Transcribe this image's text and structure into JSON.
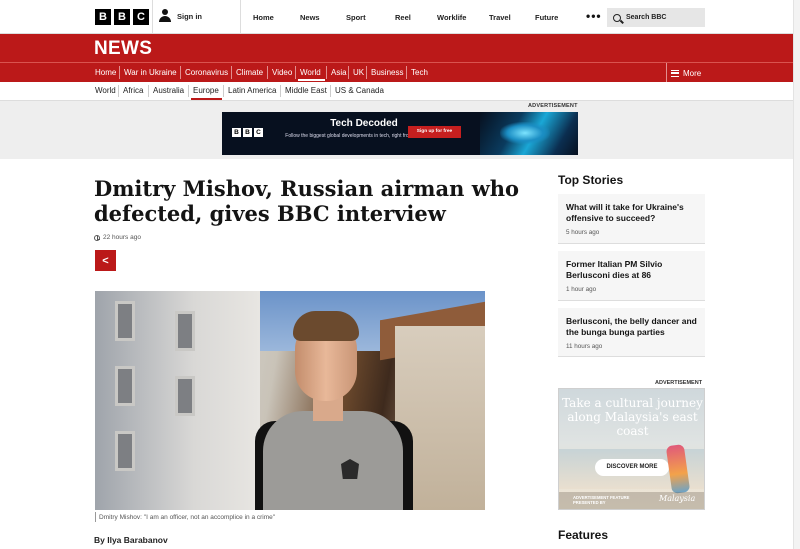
{
  "header": {
    "logo_letters": [
      "B",
      "B",
      "C"
    ],
    "signin_label": "Sign in",
    "nav": [
      "Home",
      "News",
      "Sport",
      "Reel",
      "Worklife",
      "Travel",
      "Future"
    ],
    "search_placeholder": "Search BBC"
  },
  "news_banner": {
    "title": "NEWS"
  },
  "red_nav": {
    "items": [
      "Home",
      "War in Ukraine",
      "Coronavirus",
      "Climate",
      "Video",
      "World",
      "Asia",
      "UK",
      "Business",
      "Tech"
    ],
    "active": "World",
    "more_label": "More"
  },
  "sub_nav": {
    "items": [
      "World",
      "Africa",
      "Australia",
      "Europe",
      "Latin America",
      "Middle East",
      "US & Canada"
    ],
    "active": "Europe"
  },
  "top_ad": {
    "label": "ADVERTISEMENT",
    "logo_letters": [
      "B",
      "B",
      "C"
    ],
    "title": "Tech Decoded",
    "subtitle": "Follow the biggest global developments in tech, right from your inbox.",
    "button": "Sign up for free"
  },
  "article": {
    "headline": "Dmitry Mishov, Russian airman who defected, gives BBC interview",
    "timestamp": "22 hours ago",
    "caption": "Dmitry Mishov: \"I am an officer, not an accomplice in a crime\"",
    "byline": "By Ilya Barabanov"
  },
  "sidebar": {
    "top_stories_title": "Top Stories",
    "stories": [
      {
        "title": "What will it take for Ukraine's offensive to succeed?",
        "time": "5 hours ago"
      },
      {
        "title": "Former Italian PM Silvio Berlusconi dies at 86",
        "time": "1 hour ago"
      },
      {
        "title": "Berlusconi, the belly dancer and the bunga bunga parties",
        "time": "11 hours ago"
      }
    ],
    "ad_label": "ADVERTISEMENT",
    "ad": {
      "headline": "Take a cultural journey along Malaysia's east coast",
      "button": "DISCOVER MORE",
      "footer": "ADVERTISEMENT FEATURE PRESENTED BY",
      "brand": "Malaysia"
    },
    "features_title": "Features"
  },
  "colors": {
    "bbc_red": "#bb1919",
    "text": "#141414"
  }
}
